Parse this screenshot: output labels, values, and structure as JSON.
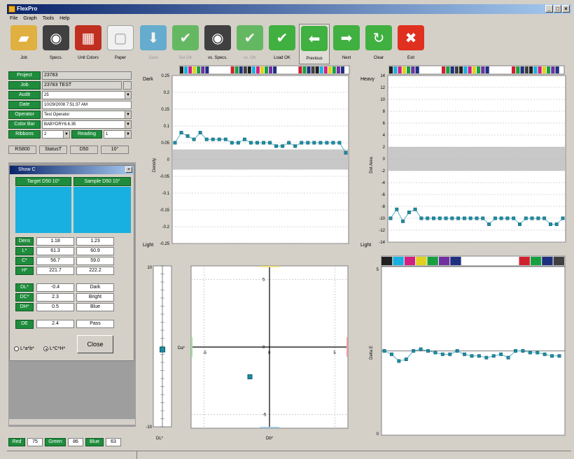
{
  "app": {
    "title": "FlexPro"
  },
  "menu": [
    "File",
    "Graph",
    "Tools",
    "Help"
  ],
  "toolbar": [
    {
      "label": "Job",
      "icon": "folder-icon",
      "color": "#e0b040",
      "enabled": true
    },
    {
      "label": "Specs.",
      "icon": "binoculars-icon",
      "color": "#404040",
      "enabled": true
    },
    {
      "label": "Unit Colors",
      "icon": "color-squares-icon",
      "color": "#c03020",
      "enabled": true
    },
    {
      "label": "Paper",
      "icon": "paper-icon",
      "color": "#f0f0f0",
      "enabled": true
    },
    {
      "label": "Save",
      "icon": "save-arrow-icon",
      "color": "#40a0d0",
      "enabled": false
    },
    {
      "label": "Set OK",
      "icon": "check-circle-icon",
      "color": "#40b040",
      "enabled": false
    },
    {
      "label": "vs. Specs.",
      "icon": "binoculars-icon",
      "color": "#404040",
      "enabled": true
    },
    {
      "label": "vs. OK",
      "icon": "check-arrow-icon",
      "color": "#40b040",
      "enabled": false
    },
    {
      "label": "Load OK",
      "icon": "check-arrow-icon",
      "color": "#40b040",
      "enabled": true
    },
    {
      "label": "Previous",
      "icon": "arrow-left-icon",
      "color": "#40b040",
      "enabled": true,
      "selected": true
    },
    {
      "label": "Next",
      "icon": "arrow-right-icon",
      "color": "#40b040",
      "enabled": true
    },
    {
      "label": "Clear",
      "icon": "refresh-icon",
      "color": "#40b040",
      "enabled": true
    },
    {
      "label": "Exit",
      "icon": "close-circle-icon",
      "color": "#e03020",
      "enabled": true
    }
  ],
  "form": {
    "project_label": "Project",
    "project_value": "23783",
    "job_label": "Job",
    "job_value": "23783 TEST",
    "audit_label": "Audit",
    "audit_value": "25",
    "date_label": "Date",
    "date_value": "10/29/2008 7:51:37 AM",
    "operator_label": "Operator",
    "operator_value": "Test Operator",
    "colorbar_label": "Color Bar",
    "colorbar_value": "BABYDRY6.6.35",
    "ribbons_label": "Ribbons",
    "ribbons_value": "2",
    "reading_label": "Reading",
    "reading_value": "1",
    "status": [
      "RS800",
      "StatusT",
      "D50",
      "10°"
    ]
  },
  "showc": {
    "title": "Show C",
    "target_header": "Target D50 10°",
    "sample_header": "Sample D50 10°",
    "swatch_color": "#18b0e0",
    "rows1": [
      {
        "label": "Dens",
        "target": "1.18",
        "sample": "1.23"
      },
      {
        "label": "L*",
        "target": "61.3",
        "sample": "60.9"
      },
      {
        "label": "C*",
        "target": "56.7",
        "sample": "59.0"
      },
      {
        "label": "H*",
        "target": "221.7",
        "sample": "222.2"
      }
    ],
    "rows2": [
      {
        "label": "DL*",
        "value": "-0.4",
        "text": "Dark"
      },
      {
        "label": "DC*",
        "value": "2.3",
        "text": "Bright"
      },
      {
        "label": "DH*",
        "value": "0.5",
        "text": "Blue"
      }
    ],
    "de": {
      "label": "DE",
      "value": "2.4",
      "text": "Pass"
    },
    "radio1": "L*a*b*",
    "radio2": "L*C*H*",
    "close_label": "Close"
  },
  "bottom": {
    "red_label": "Red",
    "red_value": "75",
    "green_label": "Green",
    "green_value": "86",
    "blue_label": "Blue",
    "blue_value": "63"
  },
  "colorbar_colors": [
    "#202020",
    "#18b0e0",
    "#d02080",
    "#e0d020",
    "#18a040",
    "#7030a0",
    "#203080",
    "#ffffff",
    "#ffffff",
    "#ffffff",
    "#ffffff",
    "#ffffff",
    "#d02030",
    "#18a040",
    "#203080",
    "#404040"
  ],
  "chart_data": [
    {
      "type": "line",
      "top_label": "Dark",
      "bottom_label": "Light",
      "ylabel": "Density",
      "ylim": [
        -0.25,
        0.25
      ],
      "yticks": [
        "0.25",
        "0.2",
        "0.15",
        "0.1",
        "0.05",
        "0",
        "-0.05",
        "-0.1",
        "-0.15",
        "-0.2",
        "-0.25"
      ],
      "band": [
        -0.03,
        0.03
      ],
      "values": [
        0.05,
        0.08,
        0.07,
        0.06,
        0.08,
        0.06,
        0.06,
        0.06,
        0.06,
        0.05,
        0.05,
        0.06,
        0.05,
        0.05,
        0.05,
        0.05,
        0.04,
        0.04,
        0.05,
        0.04,
        0.05,
        0.05,
        0.05,
        0.05,
        0.05,
        0.05,
        0.05,
        0.02
      ]
    },
    {
      "type": "line",
      "top_label": "Heavy",
      "bottom_label": "Light",
      "ylabel": "Dot Area",
      "ylim": [
        -14,
        14
      ],
      "yticks": [
        "14",
        "12",
        "10",
        "8",
        "6",
        "4",
        "2",
        "0",
        "-2",
        "-4",
        "-6",
        "-8",
        "-10",
        "-12",
        "-14"
      ],
      "band": [
        -2,
        2
      ],
      "values": [
        -10,
        -8.5,
        -10.5,
        -9,
        -8.5,
        -10,
        -10,
        -10,
        -10,
        -10,
        -10,
        -10,
        -10,
        -10,
        -10,
        -10,
        -11,
        -10,
        -10,
        -10,
        -10,
        -11,
        -10,
        -10,
        -10,
        -10,
        -11,
        -11,
        -10
      ]
    },
    {
      "type": "scatter",
      "xlabel": "Da*",
      "ylabel": "Db*",
      "xlim": [
        -6,
        6
      ],
      "ylim": [
        -6,
        6
      ],
      "xticks": [
        "-5",
        "0",
        "5"
      ],
      "yticks": [
        "5",
        "0",
        "-5"
      ],
      "points": [
        [
          -1.5,
          -2.2
        ]
      ]
    },
    {
      "type": "line",
      "top_tick": "5",
      "bottom_tick": "0",
      "ylabel": "Delta E",
      "ylim": [
        0,
        5
      ],
      "values": [
        2.5,
        2.4,
        2.2,
        2.25,
        2.5,
        2.55,
        2.5,
        2.45,
        2.4,
        2.4,
        2.5,
        2.4,
        2.35,
        2.35,
        2.3,
        2.35,
        2.4,
        2.3,
        2.5,
        2.5,
        2.45,
        2.45,
        2.4,
        2.35,
        2.35
      ]
    },
    {
      "type": "bar",
      "xlabel": "DL*",
      "ylim": [
        -10,
        10
      ],
      "top_tick": "10",
      "bottom_tick": "-10",
      "value": -0.4
    }
  ]
}
